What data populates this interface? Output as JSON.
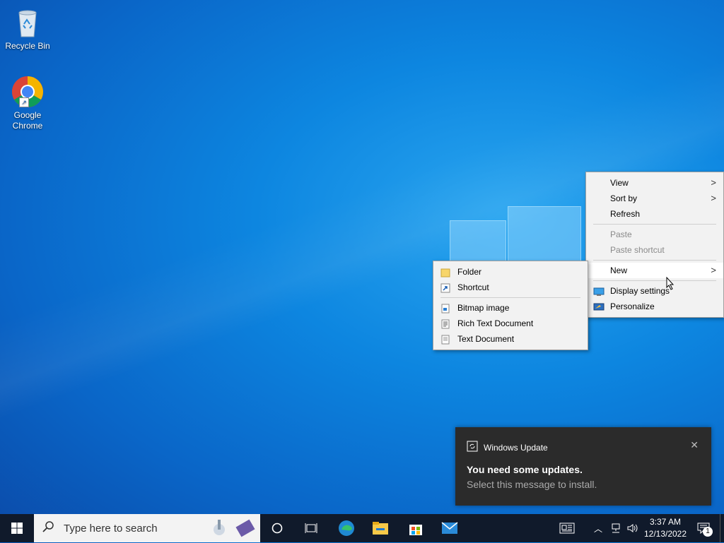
{
  "desktop": {
    "icons": [
      {
        "label": "Recycle Bin"
      },
      {
        "label_line1": "Google",
        "label_line2": "Chrome"
      }
    ]
  },
  "context_menu": {
    "view": "View",
    "sort_by": "Sort by",
    "refresh": "Refresh",
    "paste": "Paste",
    "paste_shortcut": "Paste shortcut",
    "new": "New",
    "display_settings": "Display settings",
    "personalize": "Personalize"
  },
  "new_submenu": {
    "folder": "Folder",
    "shortcut": "Shortcut",
    "bitmap_image": "Bitmap image",
    "rich_text_document": "Rich Text Document",
    "text_document": "Text Document"
  },
  "notification": {
    "app": "Windows Update",
    "title": "You need some updates.",
    "body": "Select this message to install."
  },
  "taskbar": {
    "search_placeholder": "Type here to search",
    "time": "3:37 AM",
    "date": "12/13/2022",
    "notification_count": "1"
  },
  "colors": {
    "taskbar_bg": "#101a2b",
    "menu_bg": "#f2f2f2",
    "toast_bg": "#2b2b2b",
    "accent": "#0078d7"
  }
}
